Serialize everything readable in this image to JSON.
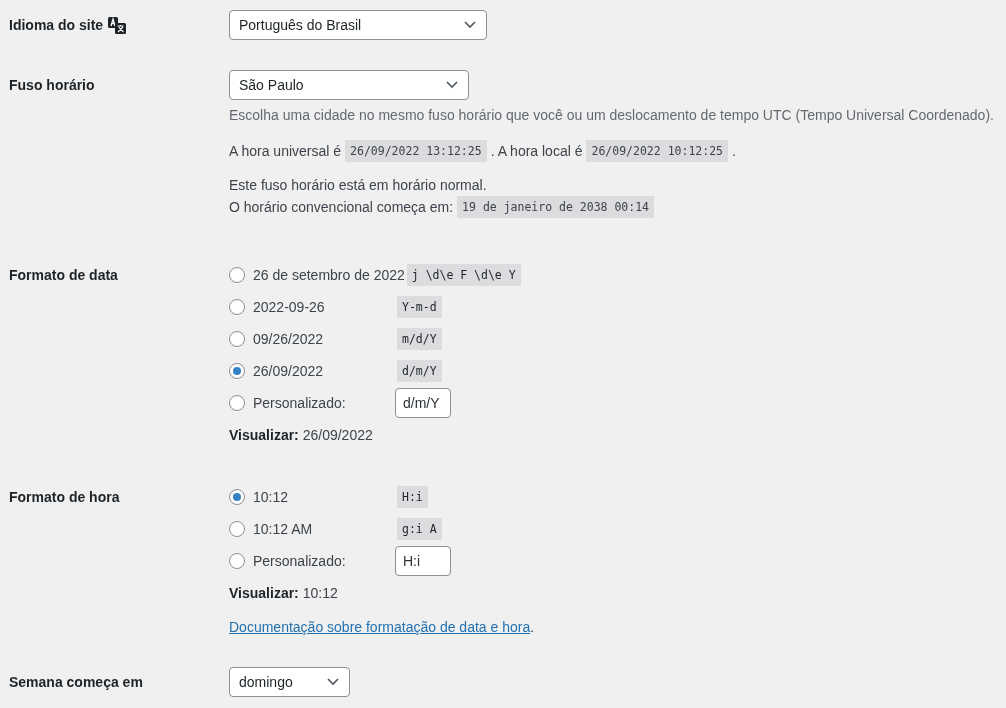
{
  "site_language": {
    "label": "Idioma do site",
    "value": "Português do Brasil"
  },
  "timezone": {
    "label": "Fuso horário",
    "value": "São Paulo",
    "description": "Escolha uma cidade no mesmo fuso horário que você ou um deslocamento de tempo UTC (Tempo Universal Coordenado).",
    "time_line": [
      {
        "kind": "text",
        "text": "A hora universal é"
      },
      {
        "kind": "code",
        "text": "26/09/2022 13:12:25"
      },
      {
        "kind": "text",
        "text": ". A hora local é"
      },
      {
        "kind": "code",
        "text": "26/09/2022 10:12:25"
      },
      {
        "kind": "text",
        "text": "."
      }
    ],
    "dst_note": "Este fuso horário está em horário normal.",
    "dst_line": [
      {
        "kind": "text",
        "text": "O horário convencional começa em:"
      },
      {
        "kind": "code",
        "text": "19 de janeiro de 2038 00:14"
      }
    ]
  },
  "date_format": {
    "label": "Formato de data",
    "options": [
      {
        "kind": "preset",
        "label": "26 de setembro de 2022",
        "format": "j \\d\\e F \\d\\e Y",
        "selected": false
      },
      {
        "kind": "preset",
        "label": "2022-09-26",
        "format": "Y-m-d",
        "selected": false
      },
      {
        "kind": "preset",
        "label": "09/26/2022",
        "format": "m/d/Y",
        "selected": false
      },
      {
        "kind": "preset",
        "label": "26/09/2022",
        "format": "d/m/Y",
        "selected": true
      },
      {
        "kind": "custom",
        "label": "Personalizado:",
        "format": "d/m/Y",
        "selected": false
      }
    ],
    "preview_label": "Visualizar:",
    "preview_value": "26/09/2022"
  },
  "time_format": {
    "label": "Formato de hora",
    "options": [
      {
        "kind": "preset",
        "label": "10:12",
        "format": "H:i",
        "selected": true
      },
      {
        "kind": "preset",
        "label": "10:12 AM",
        "format": "g:i A",
        "selected": false
      },
      {
        "kind": "custom",
        "label": "Personalizado:",
        "format": "H:i",
        "selected": false
      }
    ],
    "preview_label": "Visualizar:",
    "preview_value": "10:12",
    "doc_link": "Documentação sobre formatação de data e hora",
    "doc_suffix": "."
  },
  "week_start": {
    "label": "Semana começa em",
    "value": "domingo"
  }
}
